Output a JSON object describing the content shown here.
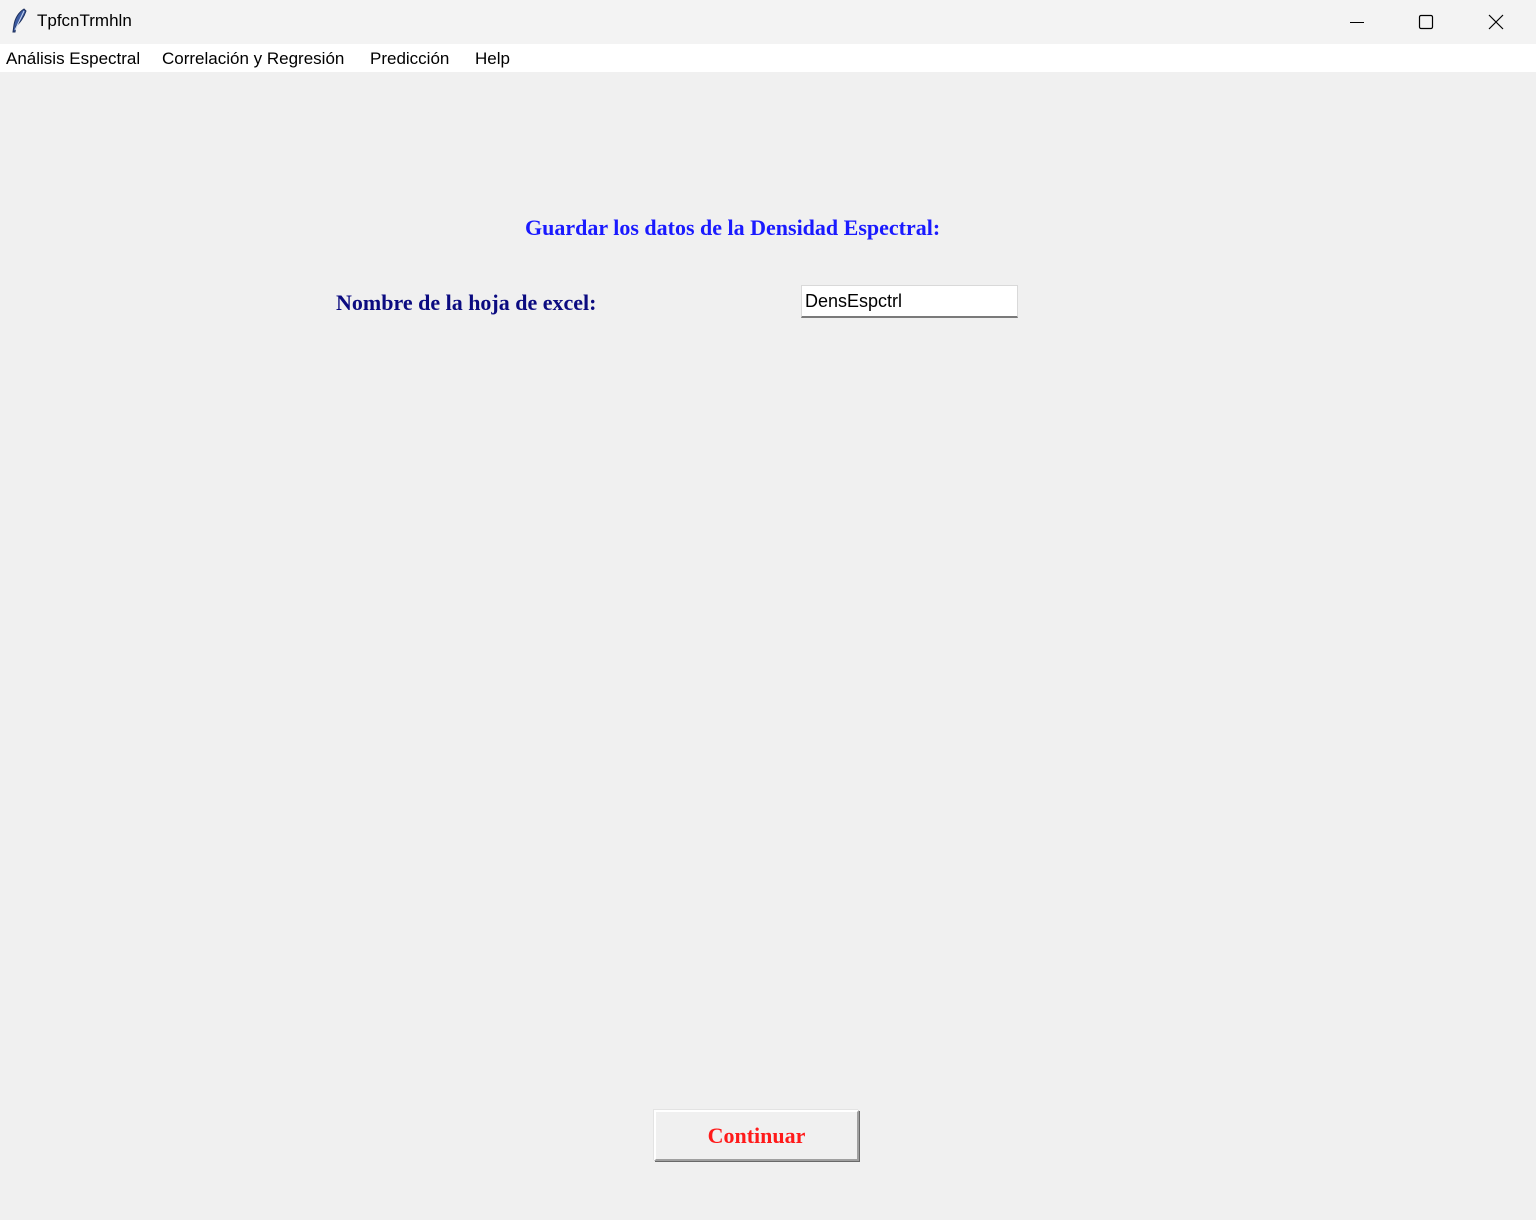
{
  "window": {
    "title": "TpfcnTrmhln",
    "controls": {
      "minimize_icon": "minimize-icon",
      "maximize_icon": "maximize-icon",
      "close_icon": "close-icon"
    }
  },
  "menubar": {
    "items": [
      {
        "label": "Análisis Espectral"
      },
      {
        "label": "Correlación y Regresión"
      },
      {
        "label": "Predicción"
      },
      {
        "label": "Help"
      }
    ]
  },
  "main": {
    "heading": "Guardar los datos de la Densidad Espectral:",
    "sheet_name_label": "Nombre de la hoja de excel:",
    "sheet_name_value": "DensEspctrl",
    "continue_label": "Continuar"
  },
  "colors": {
    "heading": "#1a1aff",
    "label": "#0b0b80",
    "button_text": "#ff1a1a",
    "background": "#f0f0f0"
  }
}
